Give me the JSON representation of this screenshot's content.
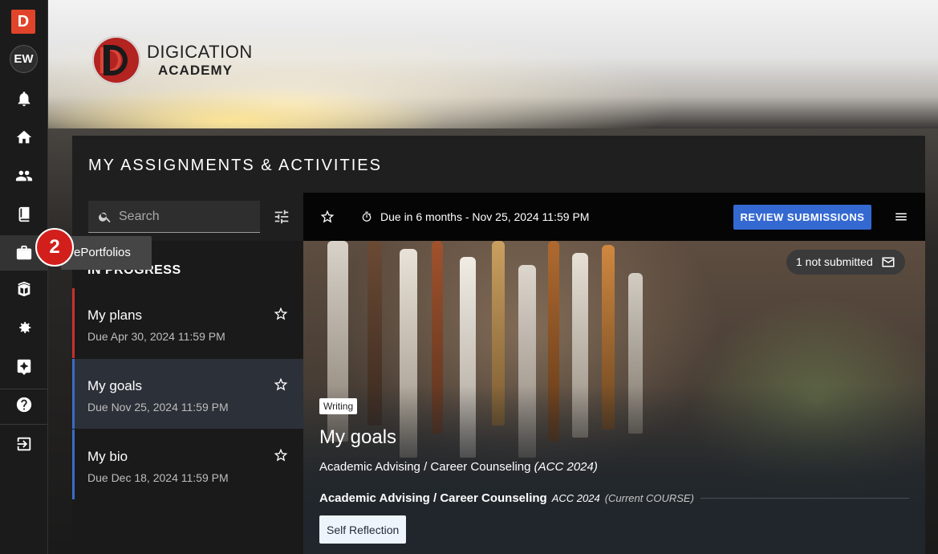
{
  "app": {
    "logo_letter": "D",
    "user_initials": "EW"
  },
  "brand": {
    "line1": "DIGICATION",
    "line2": "ACADEMY"
  },
  "nav": {
    "items": [
      {
        "icon": "bell-icon",
        "label": "Notifications"
      },
      {
        "icon": "home-icon",
        "label": "Home"
      },
      {
        "icon": "people-icon",
        "label": "People"
      },
      {
        "icon": "book-icon",
        "label": "Courses"
      },
      {
        "icon": "briefcase-icon",
        "label": "ePortfolios"
      },
      {
        "icon": "library-icon",
        "label": "Library"
      },
      {
        "icon": "settings-icon",
        "label": "Settings"
      },
      {
        "icon": "assessment-icon",
        "label": "Assessment"
      },
      {
        "icon": "help-icon",
        "label": "Help"
      },
      {
        "icon": "logout-icon",
        "label": "Log out"
      }
    ],
    "tooltip": "ePortfolios",
    "badge": "2"
  },
  "panel": {
    "title": "MY ASSIGNMENTS & ACTIVITIES"
  },
  "search": {
    "placeholder": "Search",
    "value": ""
  },
  "list": {
    "section": "IN PROGRESS",
    "items": [
      {
        "title": "My plans",
        "due": "Due Apr 30, 2024 11:59 PM",
        "accent": "#c9302c"
      },
      {
        "title": "My goals",
        "due": "Due Nov 25, 2024 11:59 PM",
        "accent": "#3b6cc7"
      },
      {
        "title": "My bio",
        "due": "Due Dec 18, 2024 11:59 PM",
        "accent": "#3b6cc7"
      }
    ]
  },
  "detail": {
    "due_text": "Due in 6 months - Nov 25, 2024 11:59 PM",
    "review_button": "REVIEW SUBMISSIONS",
    "not_submitted": "1 not submitted",
    "tag": "Writing",
    "title": "My goals",
    "course_path": "Academic Advising / Career Counseling",
    "course_path_code": "(ACC 2024)",
    "course_name": "Academic Advising / Career Counseling",
    "course_code": "ACC 2024",
    "course_status": "(Current COURSE)",
    "reflection_button": "Self Reflection"
  },
  "colors": {
    "accent_blue": "#3569d2",
    "accent_red": "#d21f1c",
    "brand_red": "#e0442a"
  }
}
